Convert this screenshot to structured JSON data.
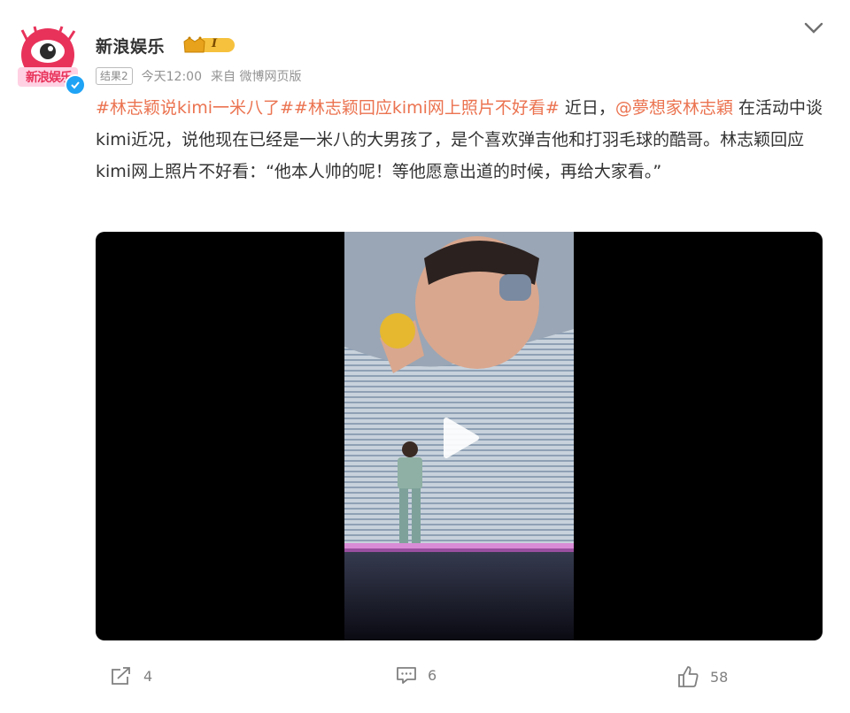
{
  "post": {
    "author": "新浪娱乐",
    "avatar_text": "新浪娱乐",
    "badge_level": "I",
    "result_tag": "结果2",
    "time": "今天12:00",
    "source": "来自 微博网页版",
    "content": {
      "topic1": "#林志颖说kimi一米八了#",
      "topic2": "#林志颖回应kimi网上照片不好看#",
      "text1": " 近日，",
      "mention": "@夢想家林志穎",
      "text2": " 在活动中谈kimi近况，说他现在已经是一米八的大男孩了，是个喜欢弹吉他和打羽毛球的酷哥。林志颖回应kimi网上照片不好看：“他本人帅的呢！等他愿意出道的时候，再给大家看。”"
    }
  },
  "actions": {
    "repost_count": "4",
    "comment_count": "6",
    "like_count": "58"
  },
  "colors": {
    "topic": "#eb7350",
    "verified": "#1ea3f5",
    "badge": "#f6c13d"
  },
  "icons": {
    "menu": "chevron-down-icon",
    "repost": "repost-icon",
    "comment": "comment-icon",
    "like": "thumbs-up-icon",
    "play": "play-icon"
  }
}
